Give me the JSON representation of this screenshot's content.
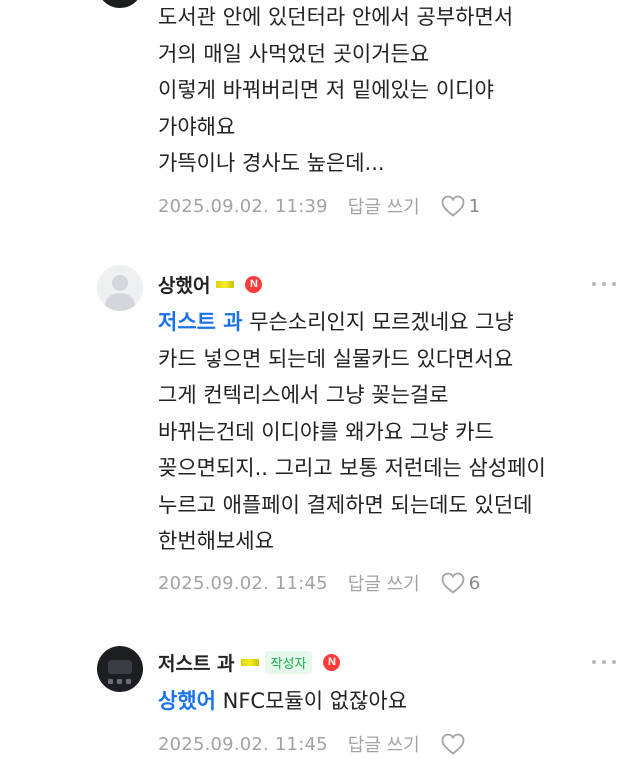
{
  "comment1": {
    "lines": "도서관 안에 있던터라 안에서 공부하면서\n거의 매일 사먹었던 곳이거든요\n이렇게 바꿔버리면 저 밑에있는 이디야\n가야해요\n가뜩이나 경사도 높은데...",
    "date": "2025.09.02. 11:39",
    "reply_label": "답글 쓰기",
    "likes": "1"
  },
  "comment2": {
    "nickname": "상했어",
    "new_badge": "N",
    "mention": "저스트 과",
    "text": " 무슨소리인지 모르겠네요 그냥\n카드 넣으면 되는데 실물카드 있다면서요\n그게 컨텍리스에서 그냥 꽂는걸로\n바뀌는건데 이디야를 왜가요 그냥 카드\n꽂으면되지.. 그리고 보통 저런데는 삼성페이\n누르고 애플페이 결제하면 되는데도 있던데\n한번해보세요",
    "date": "2025.09.02. 11:45",
    "reply_label": "답글 쓰기",
    "likes": "6"
  },
  "comment3": {
    "nickname": "저스트 과",
    "author_badge": "작성자",
    "new_badge": "N",
    "mention": "상했어",
    "text": " NFC모듈이 없잖아요",
    "date": "2025.09.02. 11:45",
    "reply_label": "답글 쓰기"
  },
  "colors": {
    "mention": "#1a73e8",
    "new_badge": "#ff3b3b",
    "author_badge": "#14b246",
    "meta_text": "#a3a3a3"
  },
  "icons": [
    "gray-avatar-icon",
    "dark-avatar-icon",
    "level-bar-icon",
    "new-badge-icon",
    "more-dots-icon",
    "heart-icon"
  ]
}
